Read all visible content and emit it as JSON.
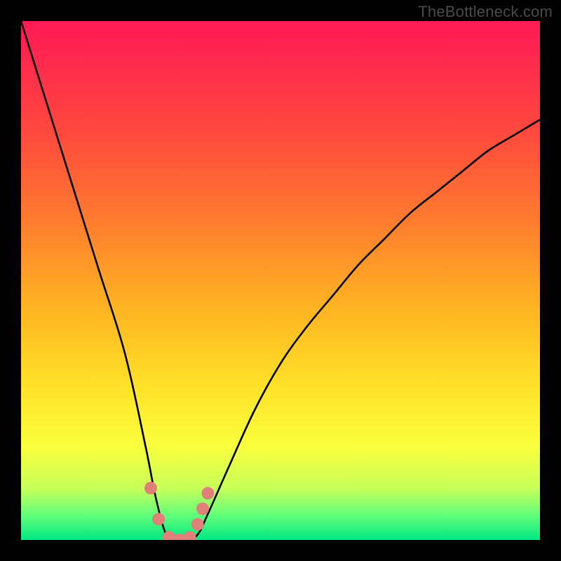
{
  "watermark": "TheBottleneck.com",
  "chart_data": {
    "type": "line",
    "title": "",
    "xlabel": "",
    "ylabel": "",
    "xlim": [
      0,
      100
    ],
    "ylim": [
      0,
      100
    ],
    "grid": false,
    "legend": false,
    "x": [
      0,
      5,
      10,
      15,
      20,
      24,
      26,
      28,
      30,
      32,
      34,
      36,
      40,
      45,
      50,
      55,
      60,
      65,
      70,
      75,
      80,
      85,
      90,
      95,
      100
    ],
    "series": [
      {
        "name": "curve",
        "values": [
          100,
          84,
          68,
          52,
          36,
          18,
          8,
          1,
          0,
          0,
          1,
          5,
          14,
          25,
          34,
          41,
          47,
          53,
          58,
          63,
          67,
          71,
          75,
          78,
          81
        ]
      }
    ],
    "markers": {
      "color": "#e08078",
      "points": [
        {
          "x": 25.0,
          "y": 10
        },
        {
          "x": 26.5,
          "y": 4
        },
        {
          "x": 28.5,
          "y": 0.5
        },
        {
          "x": 30.5,
          "y": 0
        },
        {
          "x": 32.5,
          "y": 0.5
        },
        {
          "x": 34.0,
          "y": 3
        },
        {
          "x": 35.0,
          "y": 6
        },
        {
          "x": 36.0,
          "y": 9
        }
      ]
    },
    "colors": {
      "top": "#ff1a56",
      "mid": "#ffe028",
      "bottom": "#00e884",
      "line": "#000000",
      "marker": "#e08078"
    }
  }
}
